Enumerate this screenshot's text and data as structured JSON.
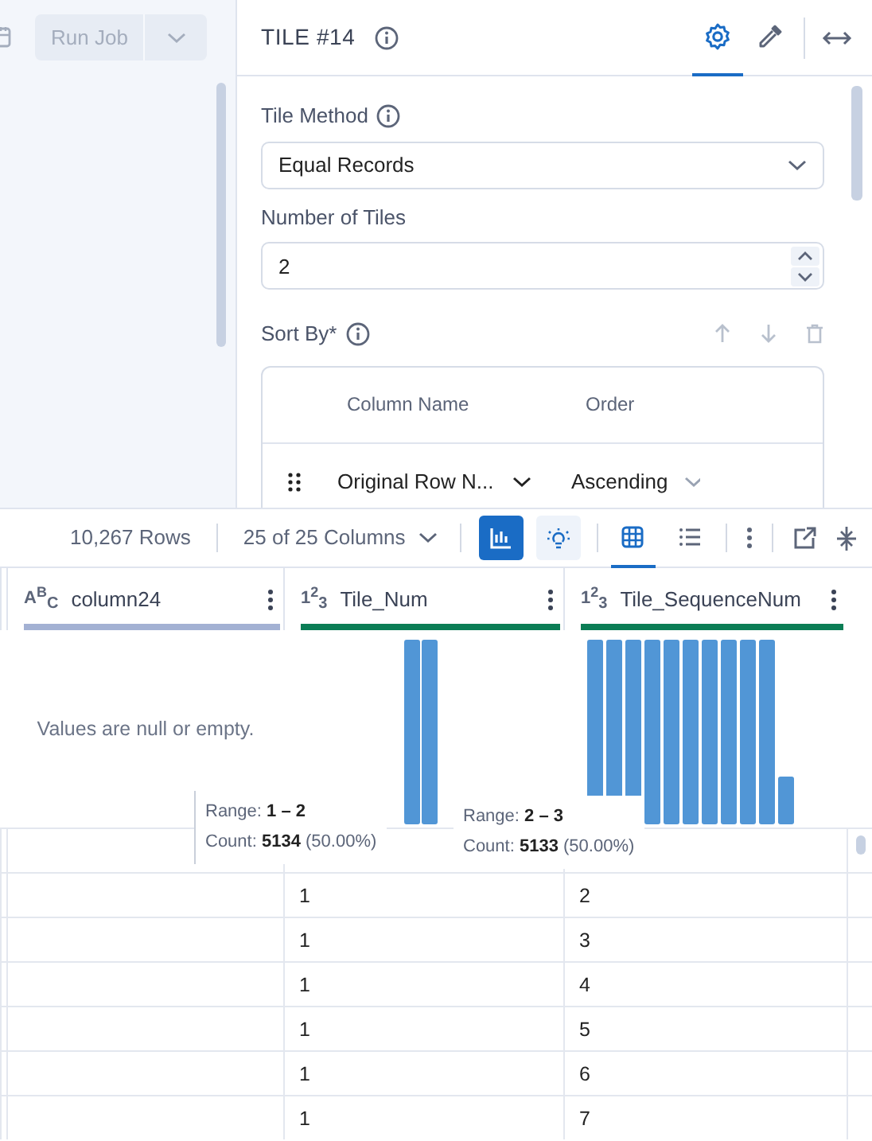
{
  "left_panel": {
    "run_button": {
      "label": "Run Job",
      "disabled": true
    }
  },
  "tile_panel": {
    "title": "TILE #14",
    "tabs": [
      {
        "kind": "settings",
        "selected": true
      },
      {
        "kind": "dropper",
        "selected": false
      }
    ],
    "tile_method": {
      "label": "Tile Method",
      "value": "Equal Records"
    },
    "number_of_tiles": {
      "label": "Number of Tiles",
      "value": "2"
    },
    "sort_by": {
      "label": "Sort By*",
      "columns": [
        "Column Name",
        "Order"
      ],
      "rows": [
        {
          "column": "Original Row N...",
          "order": "Ascending"
        }
      ]
    }
  },
  "data_toolbar": {
    "row_count": "10,267 Rows",
    "columns_dropdown": "25 of 25 Columns",
    "summary_buttons": [
      {
        "kind": "histogram",
        "on": true
      },
      {
        "kind": "insights",
        "on": false
      }
    ],
    "view_tabs": [
      {
        "kind": "grid",
        "selected": true
      },
      {
        "kind": "list",
        "selected": false
      }
    ]
  },
  "columns": [
    {
      "type_icon": "A$^{B}$$_{C}$",
      "name": "column24",
      "color": "#a3b1d3",
      "profile": {
        "kind": "empty",
        "message": "Values are null or empty."
      }
    },
    {
      "type_icon": "1$^{2}$$_{3}$",
      "name": "Tile_Num",
      "color": "#0b7d55",
      "profile": {
        "kind": "histogram"
      }
    },
    {
      "type_icon": "1$^{2}$$_{3}$",
      "name": "Tile_SequenceNum",
      "color": "#0b7d55",
      "profile": {
        "kind": "histogram"
      }
    }
  ],
  "tooltips": [
    {
      "range_label": "Range:",
      "range": "1 – 2",
      "count_label": "Count:",
      "count": "5134",
      "percent": "(50.00%)"
    },
    {
      "range_label": "Range:",
      "range": "2 – 3",
      "count_label": "Count:",
      "count": "5133",
      "percent": "(50.00%)"
    }
  ],
  "rows": [
    [
      "",
      "1",
      "2"
    ],
    [
      "",
      "1",
      "3"
    ],
    [
      "",
      "1",
      "4"
    ],
    [
      "",
      "1",
      "5"
    ],
    [
      "",
      "1",
      "6"
    ],
    [
      "",
      "1",
      "7"
    ]
  ]
}
